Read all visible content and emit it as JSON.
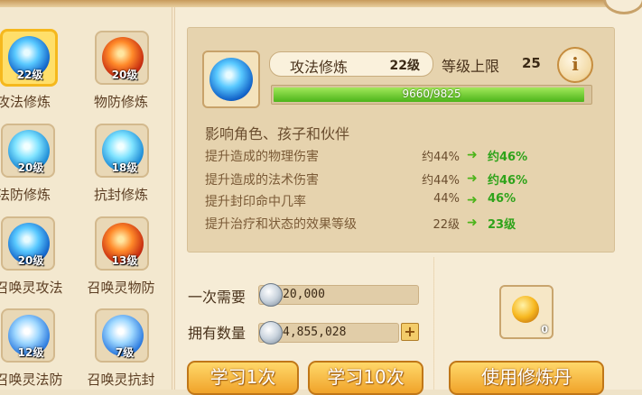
{
  "skills": [
    {
      "name": "攻法修炼",
      "level": "22级",
      "orb": "blue",
      "selected": true
    },
    {
      "name": "物防修炼",
      "level": "20级",
      "orb": "red",
      "selected": false
    },
    {
      "name": "法防修炼",
      "level": "20级",
      "orb": "teal",
      "selected": false
    },
    {
      "name": "抗封修炼",
      "level": "18级",
      "orb": "teal",
      "selected": false
    },
    {
      "name": "召唤灵攻法",
      "level": "20级",
      "orb": "blue",
      "selected": false
    },
    {
      "name": "召唤灵物防",
      "level": "13级",
      "orb": "red",
      "selected": false
    },
    {
      "name": "召唤灵法防",
      "level": "12级",
      "orb": "ice",
      "selected": false
    },
    {
      "name": "召唤灵抗封",
      "level": "7级",
      "orb": "ice",
      "selected": false
    }
  ],
  "detail": {
    "skill_name": "攻法修炼",
    "skill_level": "22级",
    "limit_label": "等级上限",
    "limit_value": "25",
    "info_icon": "i",
    "progress_text": "9660/9825",
    "progress_fraction": 0.983,
    "affects": "影响角色、孩子和伙伴",
    "effects": [
      {
        "label": "提升造成的物理伤害",
        "current": "约44%",
        "next": "约46%"
      },
      {
        "label": "提升造成的法术伤害",
        "current": "约44%",
        "next": "约46%"
      },
      {
        "label": "提升封印命中几率",
        "current": "44%",
        "next": "46%"
      },
      {
        "label": "提升治疗和状态的效果等级",
        "current": "22级",
        "next": "23级"
      }
    ]
  },
  "cost": {
    "need_label": "一次需要",
    "need_amount": "20,000",
    "have_label": "拥有数量",
    "have_amount": "4,855,028"
  },
  "item": {
    "count": "0"
  },
  "buttons": {
    "learn_once": "学习1次",
    "learn_ten": "学习10次",
    "use_pill": "使用修炼丹"
  },
  "colors": {
    "accent": "#f0a32a",
    "progress": "#4cb41a",
    "next_value": "#2ea31a"
  }
}
